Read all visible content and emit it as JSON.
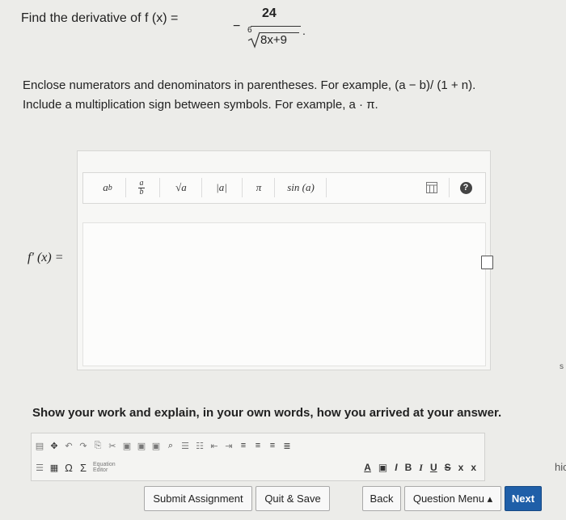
{
  "question": {
    "prefix": "Find the derivative of f (x) =",
    "neg": "−",
    "numerator": "24",
    "root_index": "6",
    "radicand": "8x+9",
    "end": "."
  },
  "instructions": {
    "line1": "Enclose numerators and denominators in parentheses. For example, (a − b)/ (1 + n).",
    "line2": "Include a multiplication sign between symbols. For example, a · π."
  },
  "toolbar": {
    "power": "ab",
    "power_base": "a",
    "power_exp": "b",
    "fraction_num": "a",
    "fraction_den": "b",
    "sqrt": "√a",
    "abs": "|a|",
    "pi": "π",
    "sin": "sin (a)",
    "help": "?"
  },
  "answer": {
    "label": "f′ (x) =",
    "value": ""
  },
  "work": {
    "title": "Show your work and explain, in your own words, how you arrived at your answer.",
    "omega": "Ω",
    "sigma": "Σ",
    "equation_editor": "Equation Editor",
    "fmt_A": "A",
    "fmt_I": "I",
    "fmt_B": "B",
    "fmt_Italic": "I",
    "fmt_U": "U",
    "fmt_S": "S",
    "fmt_sub": "x",
    "fmt_sup": "x"
  },
  "buttons": {
    "submit": "Submit Assignment",
    "quit": "Quit & Save",
    "back": "Back",
    "menu": "Question Menu ▴",
    "next": "Next"
  },
  "side": {
    "s": "s",
    "hi": "hic"
  }
}
